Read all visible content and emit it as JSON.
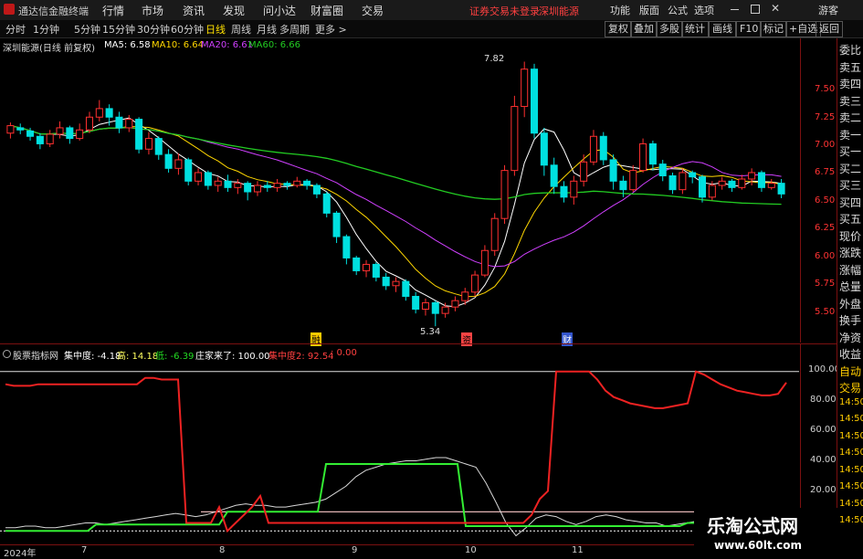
{
  "app": {
    "title": "通达信金融终端",
    "warning": "证券交易未登录",
    "stock": "深圳能源"
  },
  "menu": [
    "行情",
    "市场",
    "资讯",
    "发现",
    "问小达",
    "财富圈",
    "交易"
  ],
  "menu_right": [
    "功能",
    "版面",
    "公式",
    "选项"
  ],
  "guest": "游客",
  "periods": [
    "分时",
    "1分钟",
    "5分钟",
    "15分钟",
    "30分钟",
    "60分钟",
    "日线",
    "周线",
    "月线",
    "多周期",
    "更多 >"
  ],
  "period_active": "日线",
  "toolbar": [
    "复权",
    "叠加",
    "多股",
    "统计",
    "画线",
    "F10",
    "标记",
    "+自选",
    "返回"
  ],
  "chart_label": "深圳能源(日线 前复权)",
  "ma": [
    {
      "label": "MA5: 6.58",
      "color": "#ffffff"
    },
    {
      "label": "MA10: 6.64",
      "color": "#ffd700"
    },
    {
      "label": "MA20: 6.61",
      "color": "#d040ff"
    },
    {
      "label": "MA60: 6.66",
      "color": "#22cc22"
    }
  ],
  "price_axis": [
    "7.50",
    "7.25",
    "7.00",
    "6.75",
    "6.50",
    "6.25",
    "6.00",
    "5.75",
    "5.50"
  ],
  "annotations": {
    "high": "7.82",
    "low": "5.34"
  },
  "markers": [
    "融",
    "资",
    "财"
  ],
  "sub": {
    "name": "股票指标网",
    "conc": "集中度: -4.18",
    "high": "高: 14.18",
    "low": "低: -6.39",
    "dealer": "庄家来了: 100.00",
    "conc2": "集中度2: 92.54",
    "tail": ": 0.00"
  },
  "sub_axis": [
    "100.00",
    "80.00",
    "60.00",
    "40.00",
    "20.00"
  ],
  "x_axis": [
    "2024年",
    "7",
    "8",
    "9",
    "10",
    "11"
  ],
  "right_panel": [
    "委比",
    "卖五",
    "卖四",
    "卖三",
    "卖二",
    "卖一",
    "买一",
    "买二",
    "买三",
    "买四",
    "买五",
    "现价",
    "涨跌",
    "涨幅",
    "总量",
    "外盘",
    "换手",
    "净资",
    "收益",
    "自动",
    "交易",
    "14:50",
    "14:50",
    "14:50",
    "14:50",
    "14:50",
    "14:50",
    "14:50",
    "14:50"
  ],
  "watermark": {
    "title": "乐淘公式网",
    "url": "www.60lt.com"
  },
  "chart_data": {
    "type": "candlestick",
    "ylim": [
      5.35,
      7.85
    ],
    "candles": [
      [
        7.15,
        7.22,
        7.25,
        7.1
      ],
      [
        7.2,
        7.18,
        7.24,
        7.14
      ],
      [
        7.17,
        7.12,
        7.2,
        7.08
      ],
      [
        7.12,
        7.05,
        7.15,
        7.0
      ],
      [
        7.05,
        7.14,
        7.18,
        7.02
      ],
      [
        7.14,
        7.2,
        7.26,
        7.1
      ],
      [
        7.2,
        7.1,
        7.22,
        7.05
      ],
      [
        7.1,
        7.18,
        7.24,
        7.08
      ],
      [
        7.18,
        7.3,
        7.35,
        7.15
      ],
      [
        7.3,
        7.38,
        7.46,
        7.26
      ],
      [
        7.38,
        7.3,
        7.42,
        7.22
      ],
      [
        7.3,
        7.2,
        7.35,
        7.15
      ],
      [
        7.2,
        7.28,
        7.32,
        7.16
      ],
      [
        7.28,
        7.0,
        7.3,
        6.96
      ],
      [
        7.0,
        7.1,
        7.16,
        6.95
      ],
      [
        7.1,
        6.95,
        7.12,
        6.9
      ],
      [
        6.95,
        6.82,
        7.0,
        6.78
      ],
      [
        6.82,
        6.9,
        6.96,
        6.76
      ],
      [
        6.9,
        6.7,
        6.92,
        6.66
      ],
      [
        6.7,
        6.78,
        6.82,
        6.66
      ],
      [
        6.78,
        6.66,
        6.8,
        6.62
      ],
      [
        6.66,
        6.7,
        6.74,
        6.6
      ],
      [
        6.7,
        6.64,
        6.76,
        6.6
      ],
      [
        6.64,
        6.68,
        6.72,
        6.58
      ],
      [
        6.68,
        6.6,
        6.7,
        6.52
      ],
      [
        6.6,
        6.66,
        6.7,
        6.56
      ],
      [
        6.66,
        6.64,
        6.7,
        6.6
      ],
      [
        6.64,
        6.68,
        6.72,
        6.6
      ],
      [
        6.68,
        6.66,
        6.7,
        6.62
      ],
      [
        6.66,
        6.7,
        6.74,
        6.64
      ],
      [
        6.7,
        6.66,
        6.72,
        6.62
      ],
      [
        6.66,
        6.58,
        6.68,
        6.54
      ],
      [
        6.58,
        6.4,
        6.6,
        6.36
      ],
      [
        6.4,
        6.18,
        6.42,
        6.12
      ],
      [
        6.18,
        5.98,
        6.2,
        5.92
      ],
      [
        5.98,
        5.86,
        6.0,
        5.82
      ],
      [
        5.86,
        5.92,
        5.96,
        5.8
      ],
      [
        5.92,
        5.8,
        5.94,
        5.76
      ],
      [
        5.8,
        5.72,
        5.84,
        5.68
      ],
      [
        5.72,
        5.76,
        5.8,
        5.66
      ],
      [
        5.76,
        5.62,
        5.78,
        5.58
      ],
      [
        5.62,
        5.5,
        5.66,
        5.46
      ],
      [
        5.5,
        5.56,
        5.6,
        5.44
      ],
      [
        5.56,
        5.46,
        5.58,
        5.34
      ],
      [
        5.46,
        5.52,
        5.56,
        5.42
      ],
      [
        5.52,
        5.58,
        5.62,
        5.48
      ],
      [
        5.58,
        5.66,
        5.7,
        5.54
      ],
      [
        5.66,
        5.82,
        5.86,
        5.62
      ],
      [
        5.82,
        6.05,
        6.1,
        5.8
      ],
      [
        6.05,
        6.35,
        6.4,
        6.0
      ],
      [
        6.35,
        6.8,
        6.85,
        6.3
      ],
      [
        6.8,
        7.4,
        7.5,
        6.75
      ],
      [
        7.4,
        7.75,
        7.82,
        7.3
      ],
      [
        7.75,
        7.15,
        7.8,
        7.1
      ],
      [
        7.15,
        6.85,
        7.2,
        6.75
      ],
      [
        6.85,
        6.65,
        6.92,
        6.58
      ],
      [
        6.65,
        6.55,
        6.7,
        6.5
      ],
      [
        6.55,
        6.7,
        6.75,
        6.48
      ],
      [
        6.7,
        6.88,
        6.95,
        6.65
      ],
      [
        6.88,
        7.12,
        7.18,
        6.85
      ],
      [
        7.12,
        6.9,
        7.16,
        6.85
      ],
      [
        6.9,
        6.7,
        6.95,
        6.62
      ],
      [
        6.7,
        6.62,
        6.75,
        6.55
      ],
      [
        6.62,
        6.8,
        6.85,
        6.6
      ],
      [
        6.8,
        7.05,
        7.1,
        6.78
      ],
      [
        7.05,
        6.86,
        7.08,
        6.8
      ],
      [
        6.86,
        6.75,
        6.9,
        6.7
      ],
      [
        6.75,
        6.62,
        6.78,
        6.58
      ],
      [
        6.62,
        6.78,
        6.82,
        6.58
      ],
      [
        6.78,
        6.74,
        6.8,
        6.68
      ],
      [
        6.74,
        6.55,
        6.76,
        6.5
      ],
      [
        6.55,
        6.66,
        6.7,
        6.52
      ],
      [
        6.66,
        6.7,
        6.74,
        6.62
      ],
      [
        6.7,
        6.64,
        6.72,
        6.6
      ],
      [
        6.64,
        6.72,
        6.76,
        6.62
      ],
      [
        6.72,
        6.78,
        6.82,
        6.66
      ],
      [
        6.78,
        6.64,
        6.8,
        6.6
      ],
      [
        6.64,
        6.68,
        6.72,
        6.62
      ],
      [
        6.68,
        6.58,
        6.72,
        6.54
      ]
    ],
    "ma_series": [
      {
        "name": "MA5",
        "color": "#ffffff"
      },
      {
        "name": "MA10",
        "color": "#ffd700"
      },
      {
        "name": "MA20",
        "color": "#d040ff"
      },
      {
        "name": "MA60",
        "color": "#22cc22"
      }
    ],
    "indicator": {
      "ylim": [
        -5,
        105
      ],
      "red": [
        92,
        91,
        91,
        91,
        92,
        92,
        92,
        92,
        92,
        92,
        92,
        92,
        92,
        92,
        92,
        92,
        92,
        96,
        96,
        95,
        95,
        95,
        5,
        5,
        5,
        5,
        15,
        0,
        5,
        10,
        15,
        22,
        5,
        5,
        5,
        5,
        5,
        5,
        5,
        5,
        5,
        5,
        5,
        5,
        5,
        5,
        5,
        5,
        5,
        5,
        5,
        5,
        5,
        5,
        5,
        5,
        5,
        5,
        5,
        5,
        5,
        5,
        5,
        5,
        10,
        20,
        25,
        100,
        100,
        100,
        100,
        100,
        95,
        88,
        84,
        82,
        80,
        79,
        78,
        77,
        77,
        78,
        79,
        80,
        100,
        98,
        95,
        92,
        90,
        88,
        87,
        86,
        85,
        85,
        86,
        93
      ],
      "green": [
        0,
        0,
        0,
        0,
        0,
        0,
        0,
        0,
        0,
        0,
        0,
        4,
        4,
        4,
        4,
        4,
        4,
        4,
        4,
        4,
        4,
        4,
        4,
        4,
        4,
        4,
        4,
        12,
        12,
        12,
        12,
        12,
        12,
        12,
        12,
        12,
        12,
        12,
        12,
        42,
        42,
        42,
        42,
        42,
        42,
        42,
        42,
        42,
        42,
        42,
        42,
        42,
        42,
        42,
        42,
        42,
        3,
        3,
        3,
        3,
        3,
        3,
        3,
        3,
        3,
        3,
        3,
        3,
        3,
        3,
        3,
        3,
        3,
        3,
        3,
        3,
        3,
        3,
        3,
        3,
        3,
        3,
        3,
        5,
        5,
        5,
        5,
        5,
        5,
        5,
        5,
        5,
        5,
        7,
        8,
        10
      ],
      "white": [
        2,
        2,
        3,
        3,
        2,
        2,
        3,
        4,
        5,
        5,
        4,
        5,
        6,
        7,
        8,
        9,
        10,
        11,
        10,
        9,
        10,
        12,
        14,
        16,
        17,
        16,
        16,
        15,
        15,
        16,
        17,
        18,
        20,
        24,
        28,
        34,
        38,
        40,
        42,
        43,
        44,
        44,
        45,
        46,
        46,
        44,
        42,
        40,
        30,
        18,
        5,
        -3,
        2,
        8,
        10,
        9,
        6,
        4,
        6,
        9,
        10,
        9,
        7,
        6,
        5,
        5,
        3,
        4,
        5,
        6,
        6,
        5,
        4,
        4,
        5,
        6,
        6,
        7,
        8
      ]
    }
  }
}
